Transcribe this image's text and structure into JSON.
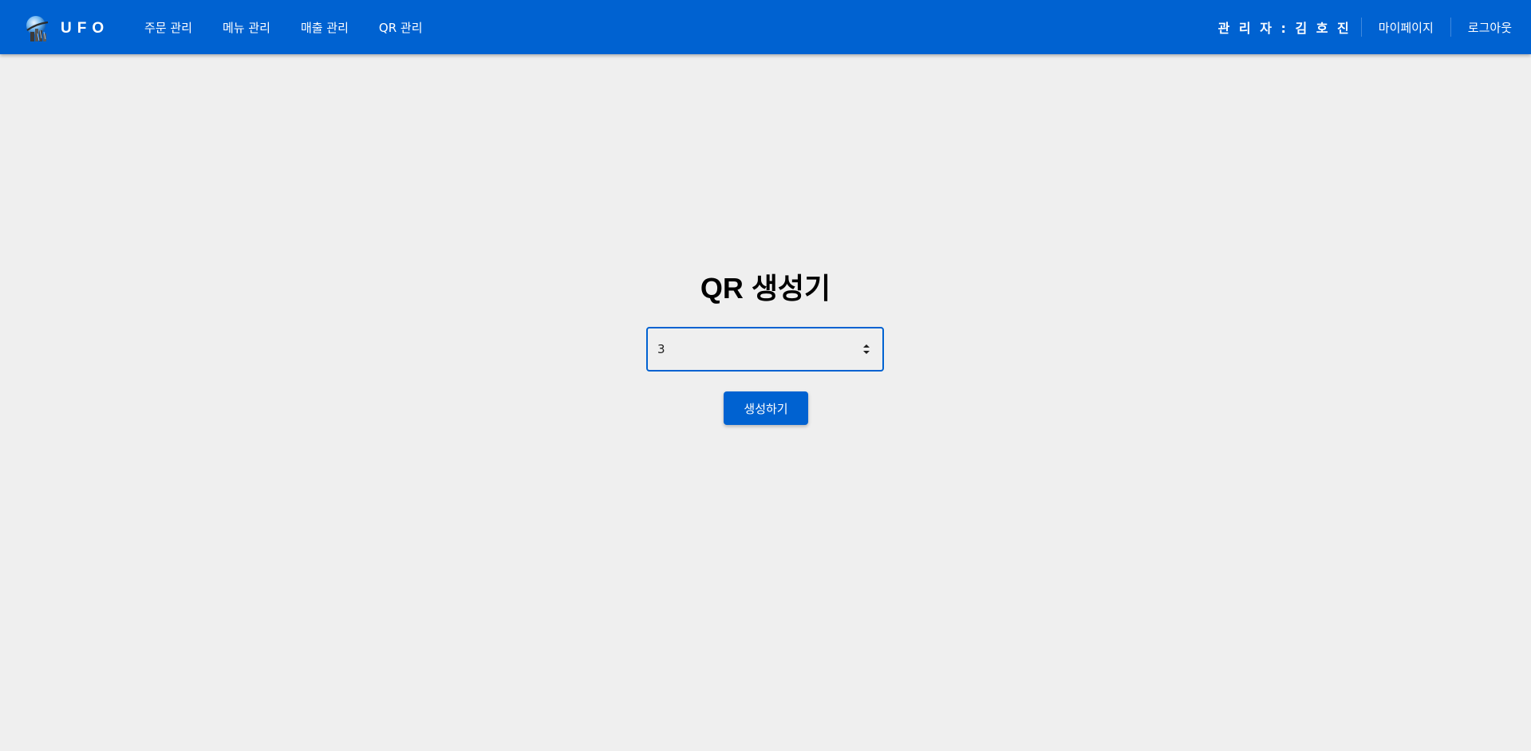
{
  "header": {
    "brand": "UFO",
    "logo_icon": "ufo-globe-logo",
    "nav_items": [
      "주문 관리",
      "메뉴 관리",
      "매출 관리",
      "QR 관리"
    ],
    "admin_label": "관 리 자 : 김 호 진",
    "mypage_label": "마이페이지",
    "logout_label": "로그아웃"
  },
  "main": {
    "title": "QR 생성기",
    "input_value": "3",
    "generate_label": "생성하기"
  },
  "colors": {
    "primary": "#0062d1",
    "background": "#efefef"
  }
}
